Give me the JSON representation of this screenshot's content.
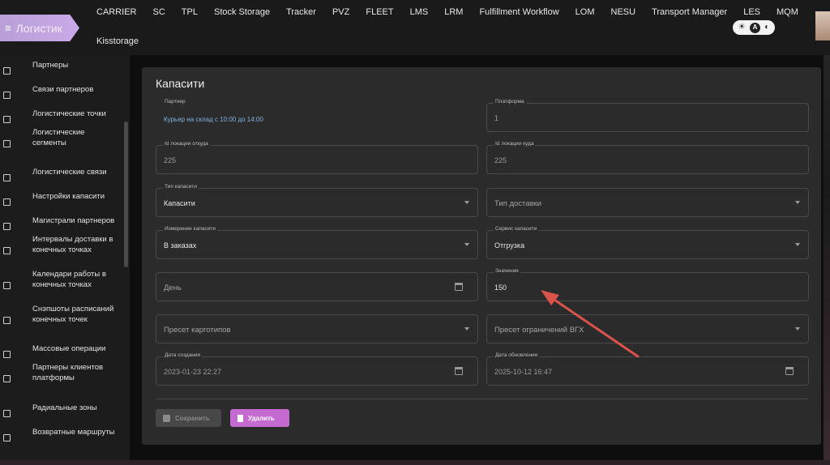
{
  "header": {
    "logo_text": "Логистик",
    "nav": [
      "CARRIER",
      "SC",
      "TPL",
      "Stock Storage",
      "Tracker",
      "PVZ",
      "FLEET",
      "LMS",
      "LRM",
      "Fulfillment Workflow",
      "LOM",
      "NESU",
      "Transport Manager",
      "LES",
      "MQM"
    ],
    "sub_nav": "Kisstorage",
    "theme_toggle": {
      "light": "☀",
      "auto": "A",
      "dark": "◐"
    }
  },
  "sidebar": {
    "items": [
      {
        "label": "Партнеры"
      },
      {
        "label": "Связи партнеров"
      },
      {
        "label": "Логистические точки"
      },
      {
        "label": "Логистические сегменты"
      },
      {
        "label": "Логистические связи"
      },
      {
        "label": "Настройки капасити"
      },
      {
        "label": "Магистрали партнеров"
      },
      {
        "label": "Интервалы доставки в конечных точках"
      },
      {
        "label": "Календари работы в конечных точках"
      },
      {
        "label": "Снэпшоты расписаний конечных точек"
      },
      {
        "label": "Массовые операции"
      },
      {
        "label": "Партнеры клиентов платформы"
      },
      {
        "label": "Радиальные зоны"
      },
      {
        "label": "Возвратные маршруты"
      }
    ]
  },
  "form": {
    "title": "Капасити",
    "fields": {
      "partner": {
        "label": "Партнер",
        "value": "Курьер на склад с 10:00 до 14:00"
      },
      "platform": {
        "label": "Платформа",
        "value": "1"
      },
      "loc_from": {
        "label": "Id локации откуда",
        "value": "225"
      },
      "loc_to": {
        "label": "Id локации куда",
        "value": "225"
      },
      "capacity_type": {
        "label": "Тип капасити",
        "value": "Капасити"
      },
      "delivery_type": {
        "placeholder": "Тип доставки"
      },
      "capacity_measure": {
        "label": "Измерение капасити",
        "value": "В заказах"
      },
      "capacity_service": {
        "label": "Сервис капасити",
        "value": "Отгрузка"
      },
      "day": {
        "placeholder": "День"
      },
      "value": {
        "label": "Значение",
        "value": "150"
      },
      "cargo_preset": {
        "placeholder": "Пресет карготипов"
      },
      "vgh_preset": {
        "placeholder": "Пресет ограничений ВГХ"
      },
      "created": {
        "label": "Дата создания",
        "value": "2023-01-23 22:27"
      },
      "updated": {
        "label": "Дата обновления",
        "value": "2025-10-12 16:47"
      }
    },
    "buttons": {
      "save": "Сохранить",
      "delete": "Удалить"
    }
  },
  "colors": {
    "accent": "#c46ad0",
    "link": "#7fb2e0",
    "annotation_arrow": "#d9534a"
  }
}
